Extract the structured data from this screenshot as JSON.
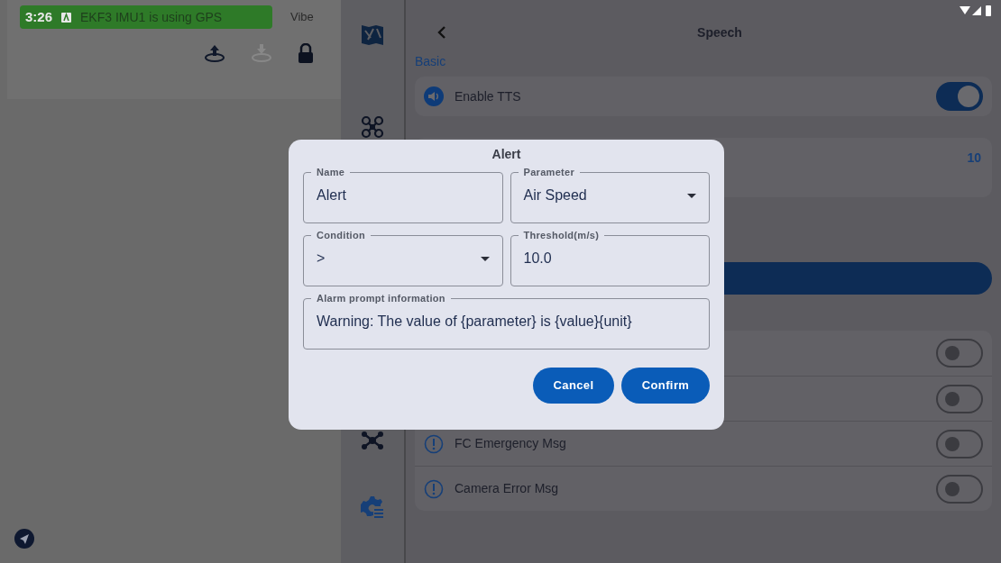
{
  "status_bar": {
    "time": "3:26",
    "message": "EKF3 IMU1 is using GPS",
    "vibe": "Vibe"
  },
  "settings": {
    "title": "Speech",
    "section": "Basic",
    "tts": {
      "label": "Enable TTS",
      "on": true
    },
    "partial_value": "10",
    "alarm_rows": [
      {
        "on": false
      },
      {
        "on": false
      },
      {
        "label": "FC Emergency Msg",
        "on": false
      },
      {
        "label": "Camera Error Msg",
        "on": false
      }
    ]
  },
  "dialog": {
    "title": "Alert",
    "fields": [
      {
        "kind": "text",
        "label": "Name",
        "value": "Alert"
      },
      {
        "kind": "select",
        "label": "Parameter",
        "value": "Air Speed"
      },
      {
        "kind": "select",
        "label": "Condition",
        "value": ">"
      },
      {
        "kind": "text",
        "label": "Threshold(m/s)",
        "value": "10.0"
      },
      {
        "kind": "text",
        "label": "Alarm prompt information",
        "value": "Warning: The value of {parameter} is {value}{unit}"
      }
    ],
    "buttons": [
      "Cancel",
      "Confirm"
    ]
  }
}
